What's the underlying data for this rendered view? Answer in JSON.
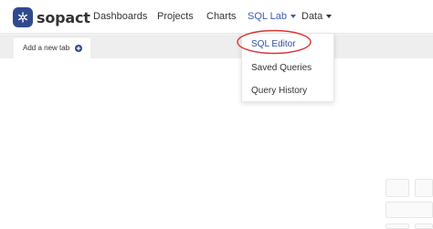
{
  "brand": {
    "name": "sopact"
  },
  "nav": {
    "items": [
      {
        "label": "Dashboards"
      },
      {
        "label": "Projects"
      },
      {
        "label": "Charts"
      },
      {
        "label": "SQL Lab"
      },
      {
        "label": "Data"
      }
    ]
  },
  "tabs": {
    "add_label": "Add a new tab"
  },
  "dropdown": {
    "items": [
      {
        "label": "SQL Editor"
      },
      {
        "label": "Saved Queries"
      },
      {
        "label": "Query History"
      }
    ]
  },
  "colors": {
    "brand": "#2f4a8e",
    "active_nav": "#3a5cb8",
    "annotation": "#d93636"
  }
}
